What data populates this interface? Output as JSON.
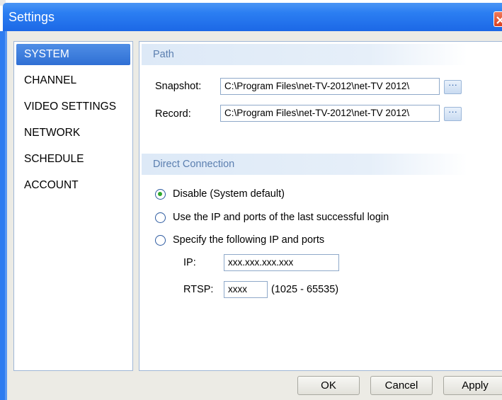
{
  "window": {
    "title": "Settings"
  },
  "nav": {
    "items": [
      {
        "label": "SYSTEM",
        "active": true
      },
      {
        "label": "CHANNEL",
        "active": false
      },
      {
        "label": "VIDEO SETTINGS",
        "active": false
      },
      {
        "label": "NETWORK",
        "active": false
      },
      {
        "label": "SCHEDULE",
        "active": false
      },
      {
        "label": "ACCOUNT",
        "active": false
      }
    ]
  },
  "path_section": {
    "header": "Path",
    "snapshot": {
      "label": "Snapshot:",
      "value": "C:\\Program Files\\net-TV-2012\\net-TV 2012\\",
      "browse_label": "···"
    },
    "record": {
      "label": "Record:",
      "value": "C:\\Program Files\\net-TV-2012\\net-TV 2012\\",
      "browse_label": "···"
    }
  },
  "direct_connection": {
    "header": "Direct Connection",
    "options": [
      {
        "label": "Disable (System default)",
        "checked": true
      },
      {
        "label": "Use the IP and ports of the last successful login",
        "checked": false
      },
      {
        "label": "Specify the following IP and ports",
        "checked": false
      }
    ],
    "ip": {
      "label": "IP:",
      "value": "xxx.xxx.xxx.xxx"
    },
    "rtsp": {
      "label": "RTSP:",
      "value": "xxxx",
      "range": "(1025 - 65535)"
    }
  },
  "footer": {
    "ok_label": "OK",
    "cancel_label": "Cancel",
    "apply_label": "Apply"
  },
  "colors": {
    "titlebar": "#2b7ef2",
    "nav_active": "#3b7bdc",
    "radio_checked": "#2ea82e",
    "section_header_text": "#5b7fb0"
  }
}
